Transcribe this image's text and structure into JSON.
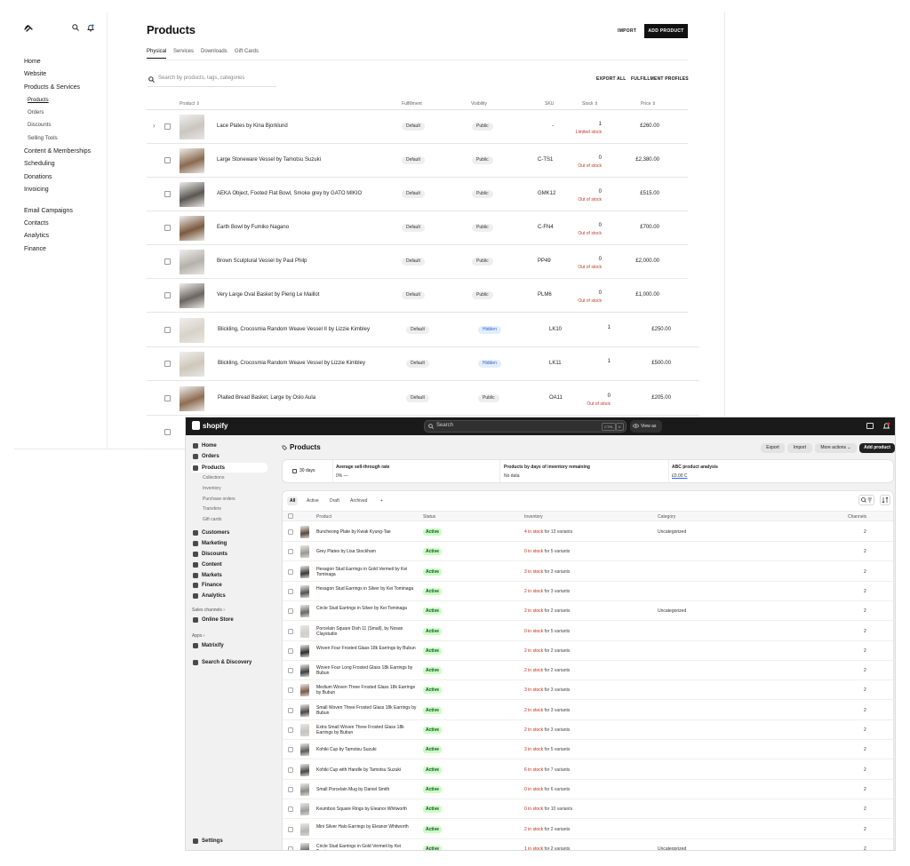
{
  "squarespace": {
    "nav": [
      {
        "label": "Home",
        "y": 52
      },
      {
        "label": "Website",
        "y": 66
      },
      {
        "label": "Products & Services",
        "y": 81
      }
    ],
    "subnav": [
      {
        "label": "Products",
        "active": true
      },
      {
        "label": "Orders"
      },
      {
        "label": "Discounts"
      },
      {
        "label": "Selling Tools"
      }
    ],
    "nav2": [
      "Content & Memberships",
      "Scheduling",
      "Donations",
      "Invoicing"
    ],
    "nav3": [
      "Email Campaigns",
      "Contacts",
      "Analytics",
      "Finance"
    ],
    "title": "Products",
    "import_label": "IMPORT",
    "add_label": "ADD PRODUCT",
    "tabs": [
      "Physical",
      "Services",
      "Downloads",
      "Gift Cards"
    ],
    "search_placeholder": "Search by products, tags, categories",
    "export_label": "EXPORT ALL",
    "fulfillment_label": "FULFILLMENT PROFILES",
    "headers": {
      "product": "Product ⇕",
      "fulfillment": "Fulfillment",
      "visibility": "Visibility",
      "sku": "SKU",
      "stock": "Stock ⇕",
      "price": "Price ⇕"
    },
    "rows": [
      {
        "name": "Lace Plates by Kina Bjorklund",
        "fulfillment": "Default",
        "visibility": "Public",
        "sku": "-",
        "stock": "1",
        "note": "Limited stock",
        "price": "£260.00",
        "color": "#c9c6c0"
      },
      {
        "name": "Large Stoneware Vessel by Tamotsu Suzuki",
        "fulfillment": "Default",
        "visibility": "Public",
        "sku": "C-TS1",
        "stock": "0",
        "note": "Out of stock",
        "price": "£2,380.00",
        "color": "#8a6a4f"
      },
      {
        "name": "AEKA Object, Footed Flat Bowl, Smoke grey by GATO MIKIO",
        "fulfillment": "Default",
        "visibility": "Public",
        "sku": "GMK12",
        "stock": "0",
        "note": "Out of stock",
        "price": "£515.00",
        "color": "#5a5753"
      },
      {
        "name": "Earth Bowl by Fumiko Nagano",
        "fulfillment": "Default",
        "visibility": "Public",
        "sku": "C-FN4",
        "stock": "0",
        "note": "Out of stock",
        "price": "£700.00",
        "color": "#7b5a40"
      },
      {
        "name": "Brown Sculptural Vessel by Paul Philp",
        "fulfillment": "Default",
        "visibility": "Public",
        "sku": "PP49",
        "stock": "0",
        "note": "Out of stock",
        "price": "£2,000.00",
        "color": "#b5b1ab"
      },
      {
        "name": "Very Large Oval Basket by Pierig Le Maillot",
        "fulfillment": "Default",
        "visibility": "Public",
        "sku": "PLM6",
        "stock": "0",
        "note": "Out of stock",
        "price": "£1,000.00",
        "color": "#6b6560"
      },
      {
        "name": "Blickling, Crocosmia Random Weave Vessel II by Lizzie Kimbley",
        "fulfillment": "Default",
        "visibility": "Hidden",
        "sku": "LK10",
        "stock": "1",
        "note": "",
        "price": "£250.00",
        "color": "#d8d2c8"
      },
      {
        "name": "Blickling, Crocosmia Random Weave Vessel by Lizzie Kimbley",
        "fulfillment": "Default",
        "visibility": "Hidden",
        "sku": "LK11",
        "stock": "1",
        "note": "",
        "price": "£500.00",
        "color": "#cfc7bb"
      },
      {
        "name": "Plaited Bread Basket, Large by Oslo Aula",
        "fulfillment": "Default",
        "visibility": "Public",
        "sku": "OA11",
        "stock": "0",
        "note": "Out of stock",
        "price": "£205.00",
        "color": "#8e6d52"
      }
    ]
  },
  "shopify": {
    "brand": "shopify",
    "search_placeholder": "Search",
    "kbd1": "CTRL",
    "kbd2": "K",
    "view_as": "View as",
    "nav_top": [
      {
        "label": "Home"
      },
      {
        "label": "Orders"
      },
      {
        "label": "Products",
        "active": true
      }
    ],
    "product_sub": [
      "Collections",
      "Inventory",
      "Purchase orders",
      "Transfers",
      "Gift cards"
    ],
    "nav_mid": [
      "Customers",
      "Marketing",
      "Discounts",
      "Content",
      "Markets",
      "Finance",
      "Analytics"
    ],
    "sales_channels": "Sales channels ›",
    "online_store": "Online Store",
    "apps": "Apps ›",
    "matrixify": "Matrixify",
    "search_discovery": "Search & Discovery",
    "settings": "Settings",
    "title": "Products",
    "buttons": {
      "export": "Export",
      "import": "Import",
      "more": "More actions ⌄",
      "add": "Add product"
    },
    "stats": {
      "days": "30 days",
      "a_label": "Average sell-through rate",
      "a_value": "0%  —",
      "b_label": "Products by days of inventory remaining",
      "b_value": "No data",
      "c_label": "ABC product analysis",
      "c_value": "£0.00 C"
    },
    "tabs": [
      "All",
      "Active",
      "Draft",
      "Archived",
      "+"
    ],
    "headers": {
      "product": "Product",
      "status": "Status",
      "inventory": "Inventory",
      "category": "Category",
      "channels": "Channels"
    },
    "rows": [
      {
        "name": "Buncheong Plate by Kwak Kyung-Tae",
        "stock": "4 in stock",
        "variants": " for 13 variants",
        "category": "Uncategorized",
        "color": "#5b4a3e"
      },
      {
        "name": "Grey Plates by Lisa Stockham",
        "stock": "0 in stock",
        "variants": " for 5 variants",
        "category": "",
        "color": "#9a9894"
      },
      {
        "name": "Hexagon Stud Earrings in Gold Vermeil by Kei Tominaga",
        "stock": "3 in stock",
        "variants": " for 3 variants",
        "category": "",
        "color": "#3b3a38"
      },
      {
        "name": "Hexagon Stud Earrings in Silver by Kei Tominaga",
        "stock": "2 in stock",
        "variants": " for 3 variants",
        "category": "",
        "color": "#555350"
      },
      {
        "name": "Circle Stud Earrings in Silver by Kei Tominaga",
        "stock": "2 in stock",
        "variants": " for 2 variants",
        "category": "Uncategorized",
        "color": "#6c6a66"
      },
      {
        "name": "Porcelain Square Dish 11 (Small), by Nosan Claystudio",
        "stock": "0 in stock",
        "variants": " for 5 variants",
        "category": "",
        "color": "#d1cfcb"
      },
      {
        "name": "Woven Four Frosted Glass 18k Earrings by Bubun",
        "stock": "2 in stock",
        "variants": " for 2 variants",
        "category": "",
        "color": "#2f2e2c"
      },
      {
        "name": "Woven Four Long Frosted Glass 18k Earrings by Bubun",
        "stock": "2 in stock",
        "variants": " for 2 variants",
        "category": "",
        "color": "#403e3b"
      },
      {
        "name": "Medium Woven Three Frosted Glass 18k Earrings by Bubun",
        "stock": "3 in stock",
        "variants": " for 3 variants",
        "category": "",
        "color": "#7a5b48"
      },
      {
        "name": "Small Woven Three Frosted Glass 18k Earrings by Bubun",
        "stock": "2 in stock",
        "variants": " for 3 variants",
        "category": "",
        "color": "#4a4845"
      },
      {
        "name": "Extra Small Woven Three Frosted Glass 18k Earrings by Bubun",
        "stock": "2 in stock",
        "variants": " for 3 variants",
        "category": "",
        "color": "#c7c4bf"
      },
      {
        "name": "Kohiki Cup by Tamotsu Suzuki",
        "stock": "3 in stock",
        "variants": " for 5 variants",
        "category": "",
        "color": "#5e5a55"
      },
      {
        "name": "Kohiki Cup with Handle by Tamotsu Suzuki",
        "stock": "6 in stock",
        "variants": " for 7 variants",
        "category": "",
        "color": "#4b4844"
      },
      {
        "name": "Small Porcelain Mug by Daniel Smith",
        "stock": "0 in stock",
        "variants": " for 6 variants",
        "category": "",
        "color": "#8f8c87"
      },
      {
        "name": "Keumboo Square Rings by Eleanor Whitworth",
        "stock": "0 in stock",
        "variants": " for 10 variants",
        "category": "",
        "color": "#a19e99"
      },
      {
        "name": "Mini Silver Halo Earrings by Eleanor Whitworth",
        "stock": "2 in stock",
        "variants": " for 2 variants",
        "category": "",
        "color": "#b9b6b1"
      },
      {
        "name": "Circle Stud Earrings in Gold Vermeil by Kei Tominaga",
        "stock": "1 in stock",
        "variants": " for 2 variants",
        "category": "Uncategorized",
        "color": "#6f6c67"
      }
    ],
    "status_label": "Active",
    "channels_value": "2"
  }
}
